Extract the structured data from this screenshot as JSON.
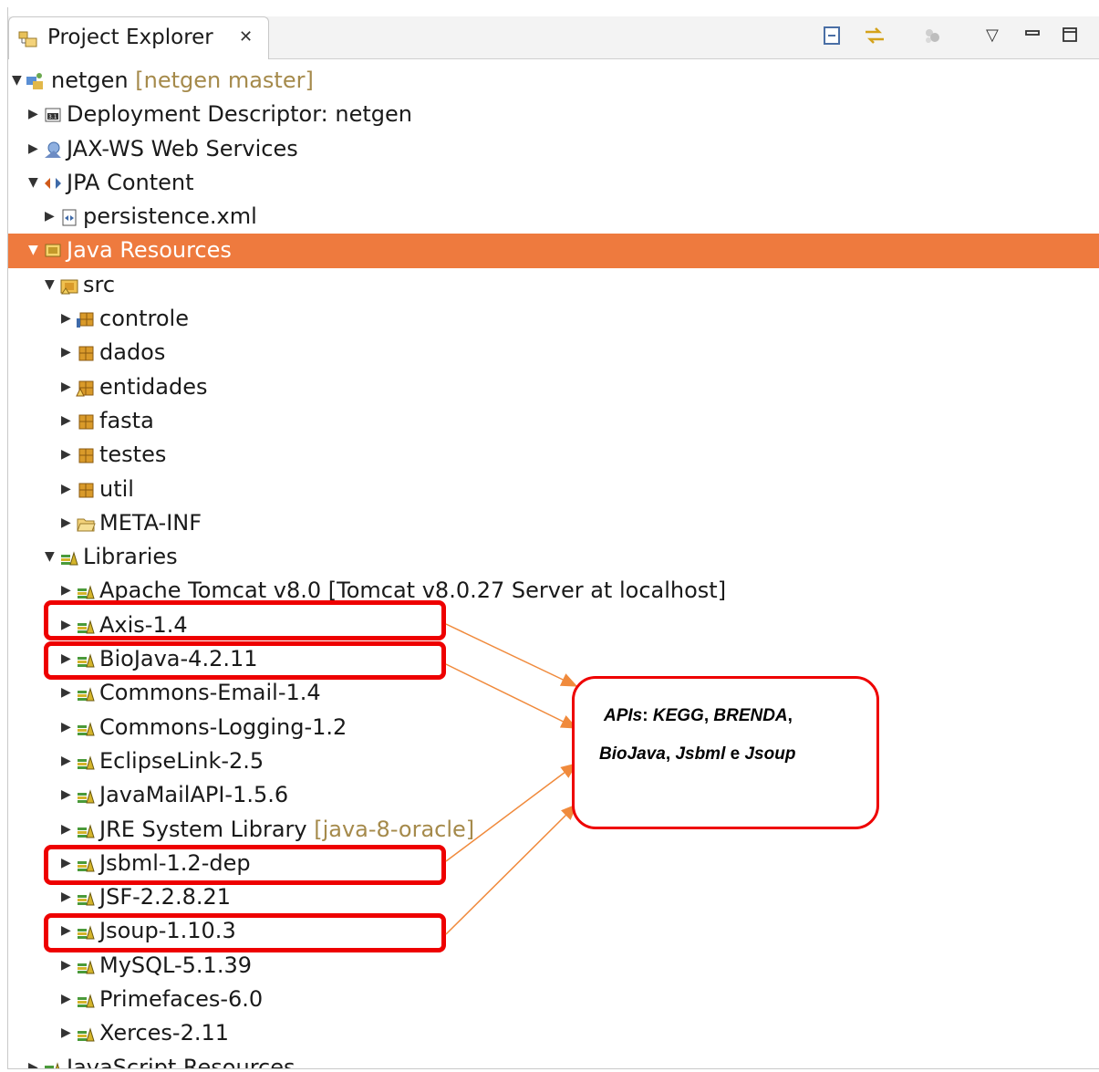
{
  "header": {
    "title": "Project Explorer",
    "close_glyph": "✕",
    "toolbar": {
      "collapse_all": "⊟",
      "link_editor": "⇆",
      "menu": "▽",
      "minimize": "▭",
      "maximize": "□"
    }
  },
  "tree": {
    "project": {
      "name": "netgen",
      "decoration": "[netgen master]"
    },
    "items": [
      {
        "label": "Deployment Descriptor: netgen"
      },
      {
        "label": "JAX-WS Web Services"
      },
      {
        "label": "JPA Content"
      },
      {
        "label": "persistence.xml"
      },
      {
        "label": "Java Resources"
      },
      {
        "label": "src"
      },
      {
        "label": "controle"
      },
      {
        "label": "dados"
      },
      {
        "label": "entidades"
      },
      {
        "label": "fasta"
      },
      {
        "label": "testes"
      },
      {
        "label": "util"
      },
      {
        "label": "META-INF"
      },
      {
        "label": "Libraries"
      }
    ],
    "libraries": [
      {
        "label": "Apache Tomcat v8.0",
        "decoration": "[Tomcat v8.0.27 Server at localhost]"
      },
      {
        "label": "Axis-1.4"
      },
      {
        "label": "BioJava-4.2.11"
      },
      {
        "label": "Commons-Email-1.4"
      },
      {
        "label": "Commons-Logging-1.2"
      },
      {
        "label": "EclipseLink-2.5"
      },
      {
        "label": "JavaMailAPI-1.5.6"
      },
      {
        "label": "JRE System Library",
        "decoration": "[java-8-oracle]"
      },
      {
        "label": "Jsbml-1.2-dep"
      },
      {
        "label": "JSF-2.2.8.21"
      },
      {
        "label": "Jsoup-1.10.3"
      },
      {
        "label": "MySQL-5.1.39"
      },
      {
        "label": "Primefaces-6.0"
      },
      {
        "label": "Xerces-2.11"
      }
    ],
    "partial_last": "JavaScript Resources"
  },
  "callout": {
    "line1": {
      "p1": "APIs",
      "p2": ": ",
      "p3": "KEGG",
      "p4": ", ",
      "p5": "BRENDA",
      "p6": ","
    },
    "line2": {
      "p1": "BioJava",
      "p2": ", ",
      "p3": "Jsbml",
      "p4": " e ",
      "p5": "Jsoup"
    }
  },
  "colors": {
    "selection": "#ee7a3e",
    "highlight": "#ee0000",
    "arrow": "#f08a3c",
    "decoration": "#a58a4b"
  }
}
